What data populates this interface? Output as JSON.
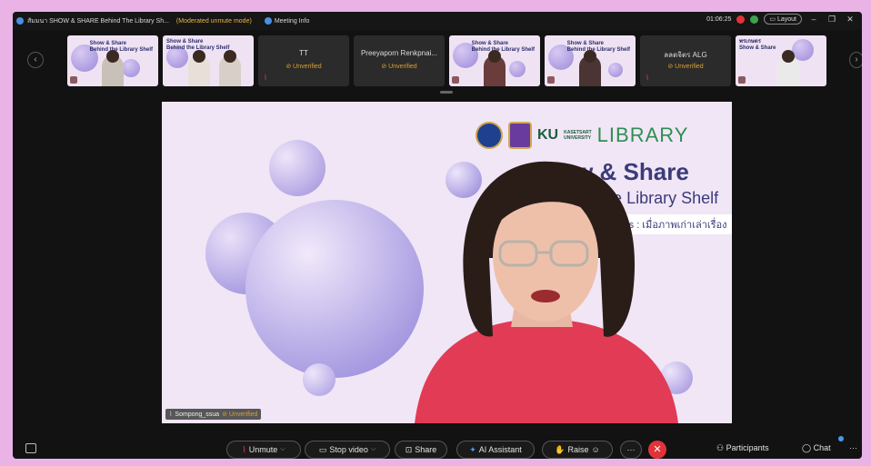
{
  "window": {
    "title": "สัมมนา SHOW & SHARE Behind The Library Sh...",
    "mode": "(Moderated unmute mode)",
    "meeting_info": "Meeting Info",
    "time": "01:06:25",
    "layout_label": "Layout"
  },
  "participants_strip": [
    {
      "type": "video",
      "title_lines": [
        "Show & Share",
        "Behind the Library Shelf"
      ]
    },
    {
      "type": "video",
      "title_lines": [
        "Show & Share",
        "Behind the Library Shelf"
      ]
    },
    {
      "type": "name",
      "name": "TT",
      "status": "Unverified"
    },
    {
      "type": "name",
      "name": "Preeyaporn Renkpnai...",
      "status": "Unverified"
    },
    {
      "type": "video",
      "title_lines": [
        "Show & Share",
        "Behind the Library Shelf"
      ]
    },
    {
      "type": "video",
      "title_lines": [
        "Show & Share",
        "Behind the Library Shelf"
      ]
    },
    {
      "type": "name",
      "name": "ลลดจิตร ALG",
      "status": "Unverified"
    },
    {
      "type": "video",
      "title_lines": [
        "พรเกษตร",
        "Show & Share"
      ]
    }
  ],
  "slide": {
    "brand_ku": "KU",
    "brand_kasetsart": "KASETSART",
    "brand_university": "UNIVERSITY",
    "brand_library": "LIBRARY",
    "title": "Show & Share",
    "subtitle": "Behind the Library Shelf",
    "tagline": "Pixel Stories : เมื่อภาพเก่าเล่าเรื่อง"
  },
  "speaker": {
    "name": "Sompong_ssua",
    "status": "Unverified"
  },
  "toolbar": {
    "unmute": "Unmute",
    "stop_video": "Stop video",
    "share": "Share",
    "ai_assistant": "AI Assistant",
    "raise": "Raise",
    "more": "···",
    "end": "✕",
    "participants": "Participants",
    "chat": "Chat",
    "overflow": "···"
  },
  "colors": {
    "outer_bg": "#e9b3e6",
    "app_bg": "#121212",
    "slide_bg": "#f1e6f6",
    "bubble": "#a797e0",
    "end_button": "#e0343a",
    "unverified": "#d9a032",
    "title_text": "#3b3b7a",
    "library_green": "#2f8f52"
  }
}
